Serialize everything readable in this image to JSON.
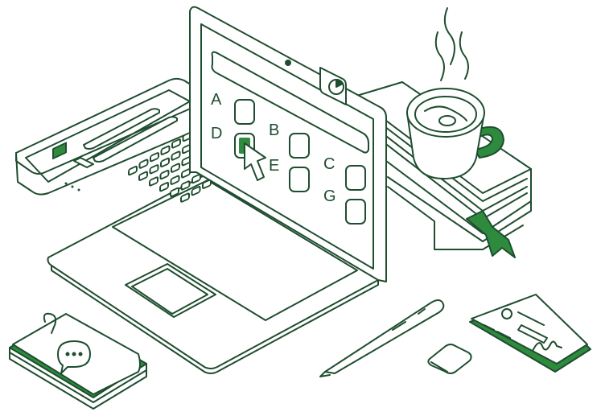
{
  "colors": {
    "ink": "#1f4d2f",
    "accent": "#2e8b3e",
    "paper": "#ffffff"
  },
  "quiz": {
    "options": [
      {
        "letter": "A",
        "selected": false
      },
      {
        "letter": "B",
        "selected": false
      },
      {
        "letter": "C",
        "selected": false
      },
      {
        "letter": "D",
        "selected": true
      },
      {
        "letter": "E",
        "selected": false
      },
      {
        "letter": "G",
        "selected": false
      }
    ]
  },
  "icons": {
    "cursor": "cursor-arrow-icon",
    "chart": "pie-chart-icon",
    "chat": "chat-bubble-icon",
    "signature": "signature-icon"
  }
}
